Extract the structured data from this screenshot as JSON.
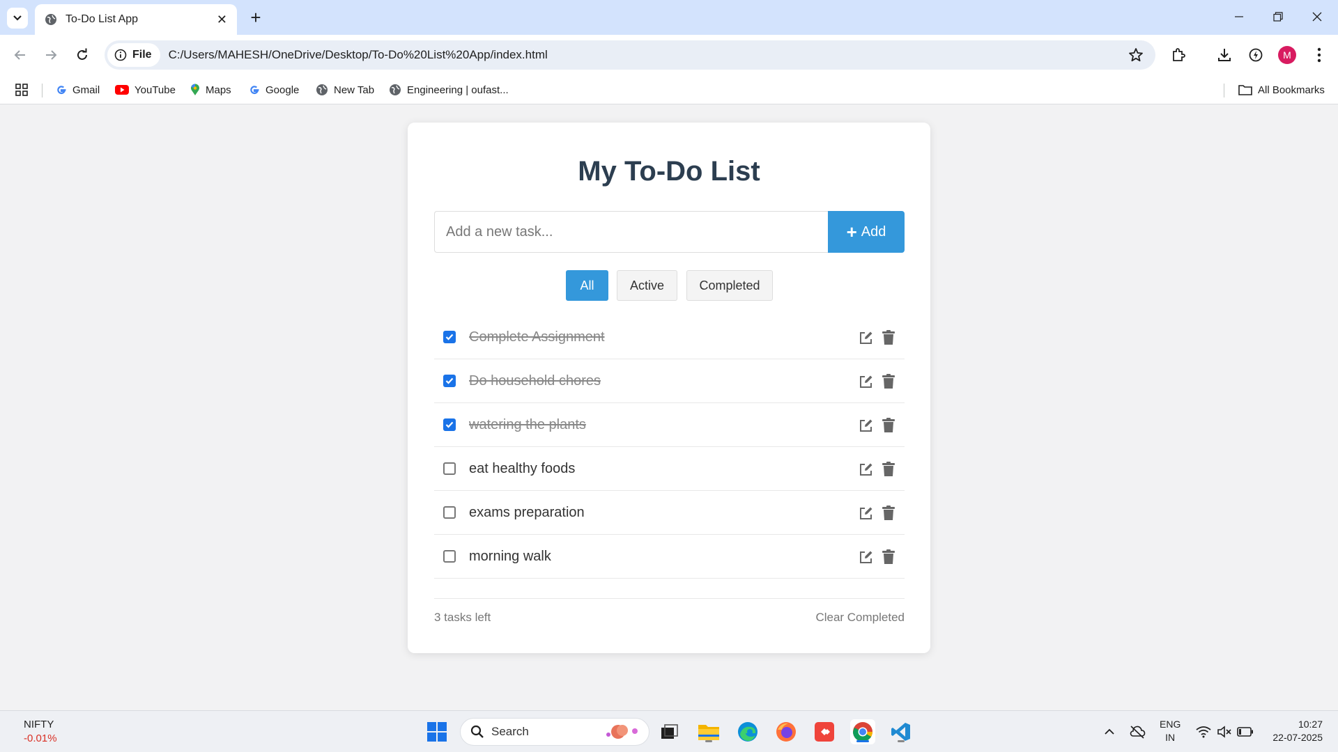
{
  "browser": {
    "tab_title": "To-Do List App",
    "site_chip_label": "File",
    "url": "C:/Users/MAHESH/OneDrive/Desktop/To-Do%20List%20App/index.html",
    "profile_initial": "M",
    "bookmarks": [
      {
        "label": "Gmail",
        "icon": "google-icon"
      },
      {
        "label": "YouTube",
        "icon": "youtube-icon"
      },
      {
        "label": "Maps",
        "icon": "maps-icon"
      },
      {
        "label": "Google",
        "icon": "google-icon"
      },
      {
        "label": "New Tab",
        "icon": "globe-icon"
      },
      {
        "label": "Engineering | oufast...",
        "icon": "globe-icon"
      }
    ],
    "all_bookmarks_label": "All Bookmarks"
  },
  "app": {
    "title": "My To-Do List",
    "input_placeholder": "Add a new task...",
    "add_button_label": "Add",
    "filters": [
      "All",
      "Active",
      "Completed"
    ],
    "active_filter": "All",
    "tasks": [
      {
        "text": "Complete Assignment",
        "completed": true
      },
      {
        "text": "Do household chores",
        "completed": true
      },
      {
        "text": "watering the plants",
        "completed": true
      },
      {
        "text": "eat healthy foods",
        "completed": false
      },
      {
        "text": "exams preparation",
        "completed": false
      },
      {
        "text": "morning walk",
        "completed": false
      }
    ],
    "tasks_left": "3 tasks left",
    "clear_completed_label": "Clear Completed"
  },
  "colors": {
    "accent": "#3498db",
    "title": "#2c3e50",
    "checkbox_checked": "#1a73e8"
  },
  "taskbar": {
    "ticker_name": "NIFTY",
    "ticker_change": "-0.01%",
    "search_label": "Search",
    "language": "ENG",
    "region": "IN",
    "time": "10:27",
    "date": "22-07-2025"
  }
}
